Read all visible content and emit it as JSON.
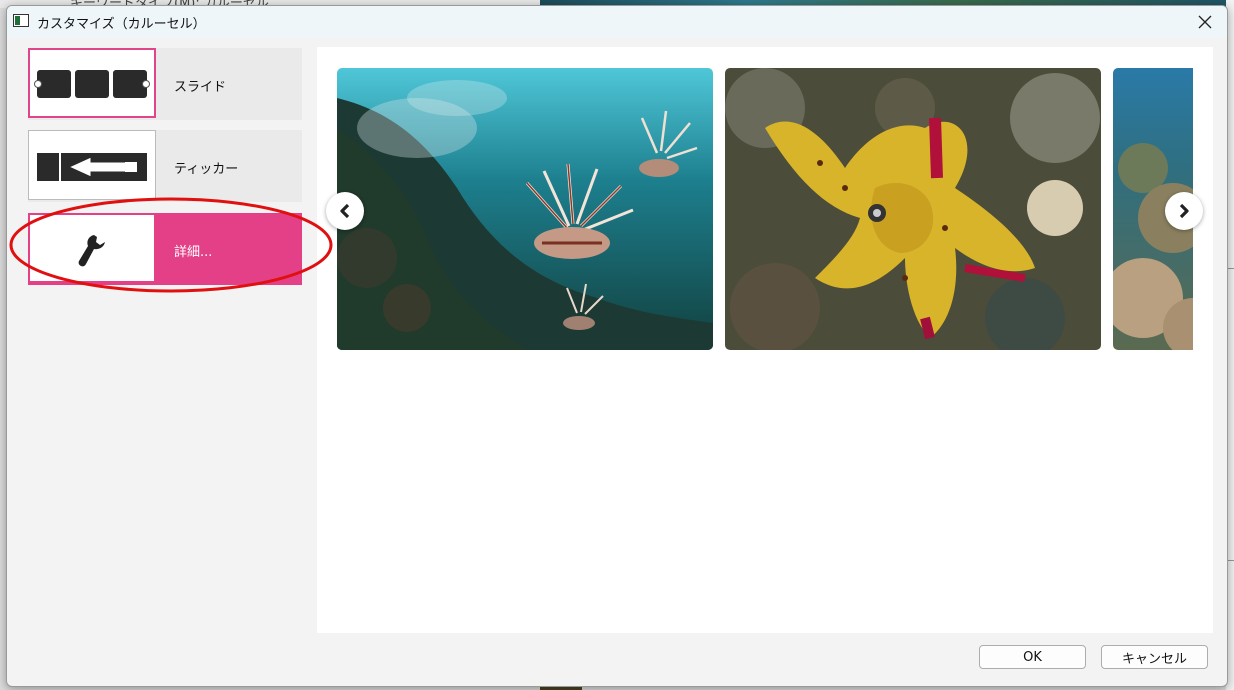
{
  "background": {
    "app_text": "キーワードタイプ(M): カルーセル"
  },
  "dialog": {
    "title": "カスタマイズ（カルーセル）",
    "close_icon": "close-icon"
  },
  "options": [
    {
      "label": "スライド",
      "icon": "slide-carousel-icon"
    },
    {
      "label": "ティッカー",
      "icon": "ticker-arrow-icon"
    },
    {
      "label": "詳細...",
      "icon": "wrench-icon",
      "active": true
    }
  ],
  "preview": {
    "photos": [
      {
        "subject": "lionfish"
      },
      {
        "subject": "cuttlefish"
      },
      {
        "subject": "coral reef"
      }
    ],
    "prev_icon": "chevron-left-icon",
    "next_icon": "chevron-right-icon"
  },
  "footer": {
    "ok_label": "OK",
    "cancel_label": "キャンセル"
  },
  "colors": {
    "accent": "#e34088",
    "annotation": "#e01010"
  }
}
